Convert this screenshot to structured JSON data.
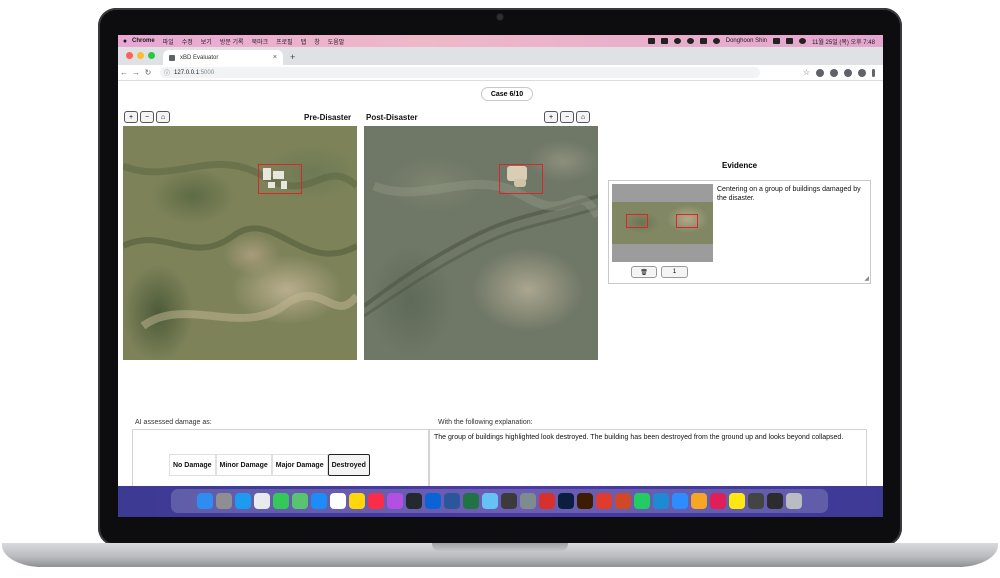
{
  "menubar": {
    "app": "Chrome",
    "items": [
      "파일",
      "수정",
      "보기",
      "방문 기록",
      "북마크",
      "프로필",
      "탭",
      "창",
      "도움말"
    ],
    "user": "Donghoon Shin",
    "datetime": "11월 25일 (목) 오후 7:48"
  },
  "browser": {
    "tab_title": "xBD Evaluator",
    "tab_close": "×",
    "new_tab": "+",
    "url_host": "127.0.0.1",
    "url_port": ":5000"
  },
  "app": {
    "case_label": "Case 6/10",
    "pre_label": "Pre-Disaster",
    "post_label": "Post-Disaster",
    "zoom_in": "+",
    "zoom_out": "−",
    "home": "⌂",
    "evidence": {
      "title": "Evidence",
      "text": "Centering on a group of buildings damaged by the disaster.",
      "delete_icon": "🗑",
      "count": "1"
    },
    "assessment": {
      "label": "AI assessed damage as:",
      "options": [
        "No Damage",
        "Minor Damage",
        "Major Damage",
        "Destroyed"
      ],
      "selected": "Destroyed"
    },
    "explanation": {
      "label": "With the following explanation:",
      "text": "The group of buildings highlighted look destroyed. The building has been destroyed from the ground up and looks beyond collapsed."
    }
  },
  "colors": {
    "bbox": "#d8262a",
    "dock_bg": "#3c3a93",
    "menubar_bg": "#efb8c8"
  },
  "dock_icons": [
    {
      "name": "finder-icon",
      "color": "#2f8cf0"
    },
    {
      "name": "launchpad-icon",
      "color": "#8e8e93"
    },
    {
      "name": "safari-icon",
      "color": "#1d9bf0"
    },
    {
      "name": "chrome-icon",
      "color": "#e8eaed"
    },
    {
      "name": "messages-icon",
      "color": "#34c759"
    },
    {
      "name": "maps-icon",
      "color": "#58c472"
    },
    {
      "name": "app-store-icon",
      "color": "#1c8cf6"
    },
    {
      "name": "calendar-icon",
      "color": "#ffffff"
    },
    {
      "name": "notes-icon",
      "color": "#ffd60a"
    },
    {
      "name": "music-icon",
      "color": "#fa2d48"
    },
    {
      "name": "podcasts-icon",
      "color": "#b150e2"
    },
    {
      "name": "github-icon",
      "color": "#24292e"
    },
    {
      "name": "outlook-icon",
      "color": "#0a64d6"
    },
    {
      "name": "word-icon",
      "color": "#2b579a"
    },
    {
      "name": "excel-icon",
      "color": "#217346"
    },
    {
      "name": "preview-icon",
      "color": "#66c1f5"
    },
    {
      "name": "terminal-alt-icon",
      "color": "#3b3b3b"
    },
    {
      "name": "system-preferences-icon",
      "color": "#7f8c8d"
    },
    {
      "name": "remote-desktop-icon",
      "color": "#d8302b"
    },
    {
      "name": "photoshop-icon",
      "color": "#0b1e3f"
    },
    {
      "name": "illustrator-icon",
      "color": "#3e1c00"
    },
    {
      "name": "acrobat-icon",
      "color": "#e03b2f"
    },
    {
      "name": "powerpoint-icon",
      "color": "#d24726"
    },
    {
      "name": "pycharm-icon",
      "color": "#23cc63"
    },
    {
      "name": "vscode-icon",
      "color": "#1f8ad2"
    },
    {
      "name": "zoom-icon",
      "color": "#2d8cff"
    },
    {
      "name": "game-icon",
      "color": "#f5a623"
    },
    {
      "name": "slack-icon",
      "color": "#e01e5a"
    },
    {
      "name": "kakaotalk-icon",
      "color": "#ffe812"
    },
    {
      "name": "obs-icon",
      "color": "#444444"
    },
    {
      "name": "activity-monitor-icon",
      "color": "#2c2c2e"
    },
    {
      "name": "trash-icon",
      "color": "#b9bcc2"
    }
  ]
}
